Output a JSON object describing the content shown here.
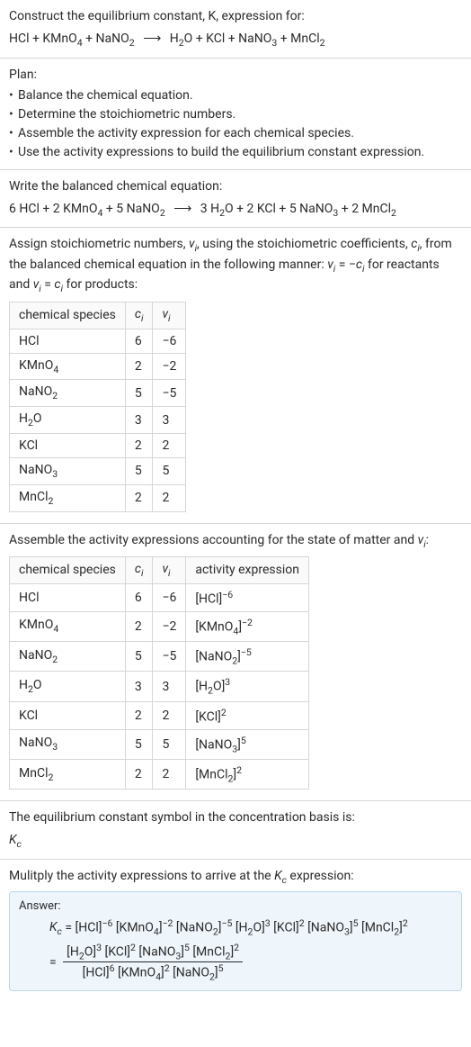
{
  "intro": {
    "line1": "Construct the equilibrium constant, K, expression for:",
    "equation_html": "HCl + KMnO<sub>4</sub> + NaNO<sub>2</sub> <span class=\"arrow\">⟶</span> H<sub>2</sub>O + KCl + NaNO<sub>3</sub> + MnCl<sub>2</sub>"
  },
  "plan": {
    "heading": "Plan:",
    "items": [
      "Balance the chemical equation.",
      "Determine the stoichiometric numbers.",
      "Assemble the activity expression for each chemical species.",
      "Use the activity expressions to build the equilibrium constant expression."
    ]
  },
  "balanced": {
    "heading": "Write the balanced chemical equation:",
    "equation_html": "6 HCl + 2 KMnO<sub>4</sub> + 5 NaNO<sub>2</sub> <span class=\"arrow\">⟶</span> 3 H<sub>2</sub>O + 2 KCl + 5 NaNO<sub>3</sub> + 2 MnCl<sub>2</sub>"
  },
  "stoich": {
    "heading_html": "Assign stoichiometric numbers, <span class=\"ital\">ν<sub>i</sub></span>, using the stoichiometric coefficients, <span class=\"ital\">c<sub>i</sub></span>, from the balanced chemical equation in the following manner: <span class=\"ital\">ν<sub>i</sub></span> = −<span class=\"ital\">c<sub>i</sub></span> for reactants and <span class=\"ital\">ν<sub>i</sub></span> = <span class=\"ital\">c<sub>i</sub></span> for products:",
    "headers": {
      "species": "chemical species",
      "ci_html": "<span class=\"ital\">c<sub>i</sub></span>",
      "vi_html": "<span class=\"ital\">ν<sub>i</sub></span>"
    },
    "rows": [
      {
        "species_html": "HCl",
        "ci": "6",
        "vi": "−6"
      },
      {
        "species_html": "KMnO<sub>4</sub>",
        "ci": "2",
        "vi": "−2"
      },
      {
        "species_html": "NaNO<sub>2</sub>",
        "ci": "5",
        "vi": "−5"
      },
      {
        "species_html": "H<sub>2</sub>O",
        "ci": "3",
        "vi": "3"
      },
      {
        "species_html": "KCl",
        "ci": "2",
        "vi": "2"
      },
      {
        "species_html": "NaNO<sub>3</sub>",
        "ci": "5",
        "vi": "5"
      },
      {
        "species_html": "MnCl<sub>2</sub>",
        "ci": "2",
        "vi": "2"
      }
    ]
  },
  "activity": {
    "heading_html": "Assemble the activity expressions accounting for the state of matter and <span class=\"ital\">ν<sub>i</sub></span>:",
    "headers": {
      "species": "chemical species",
      "ci_html": "<span class=\"ital\">c<sub>i</sub></span>",
      "vi_html": "<span class=\"ital\">ν<sub>i</sub></span>",
      "activity": "activity expression"
    },
    "rows": [
      {
        "species_html": "HCl",
        "ci": "6",
        "vi": "−6",
        "act_html": "[HCl]<sup>−6</sup>"
      },
      {
        "species_html": "KMnO<sub>4</sub>",
        "ci": "2",
        "vi": "−2",
        "act_html": "[KMnO<sub>4</sub>]<sup>−2</sup>"
      },
      {
        "species_html": "NaNO<sub>2</sub>",
        "ci": "5",
        "vi": "−5",
        "act_html": "[NaNO<sub>2</sub>]<sup>−5</sup>"
      },
      {
        "species_html": "H<sub>2</sub>O",
        "ci": "3",
        "vi": "3",
        "act_html": "[H<sub>2</sub>O]<sup>3</sup>"
      },
      {
        "species_html": "KCl",
        "ci": "2",
        "vi": "2",
        "act_html": "[KCl]<sup>2</sup>"
      },
      {
        "species_html": "NaNO<sub>3</sub>",
        "ci": "5",
        "vi": "5",
        "act_html": "[NaNO<sub>3</sub>]<sup>5</sup>"
      },
      {
        "species_html": "MnCl<sub>2</sub>",
        "ci": "2",
        "vi": "2",
        "act_html": "[MnCl<sub>2</sub>]<sup>2</sup>"
      }
    ]
  },
  "kc_symbol": {
    "heading": "The equilibrium constant symbol in the concentration basis is:",
    "symbol_html": "<span class=\"ital\">K<sub>c</sub></span>"
  },
  "multiply": {
    "heading_html": "Mulitply the activity expressions to arrive at the <span class=\"ital\">K<sub>c</sub></span> expression:"
  },
  "answer": {
    "label": "Answer:",
    "line1_html": "<span class=\"ital\">K<sub>c</sub></span> = [HCl]<sup>−6</sup> [KMnO<sub>4</sub>]<sup>−2</sup> [NaNO<sub>2</sub>]<sup>−5</sup> [H<sub>2</sub>O]<sup>3</sup> [KCl]<sup>2</sup> [NaNO<sub>3</sub>]<sup>5</sup> [MnCl<sub>2</sub>]<sup>2</sup>",
    "frac_num_html": "[H<sub>2</sub>O]<sup>3</sup> [KCl]<sup>2</sup> [NaNO<sub>3</sub>]<sup>5</sup> [MnCl<sub>2</sub>]<sup>2</sup>",
    "frac_den_html": "[HCl]<sup>6</sup> [KMnO<sub>4</sub>]<sup>2</sup> [NaNO<sub>2</sub>]<sup>5</sup>",
    "equals": "="
  }
}
